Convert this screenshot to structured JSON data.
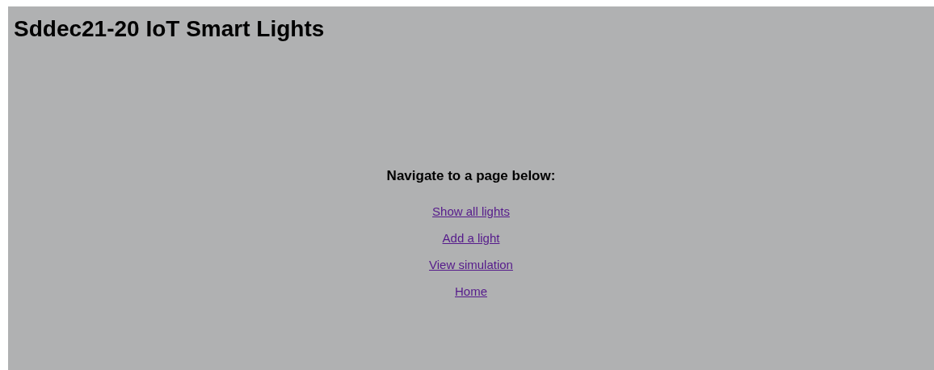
{
  "title": "Sddec21-20 IoT Smart Lights",
  "nav_heading": "Navigate to a page below:",
  "links": [
    {
      "label": "Show all lights"
    },
    {
      "label": "Add a light"
    },
    {
      "label": "View simulation"
    },
    {
      "label": "Home"
    }
  ]
}
